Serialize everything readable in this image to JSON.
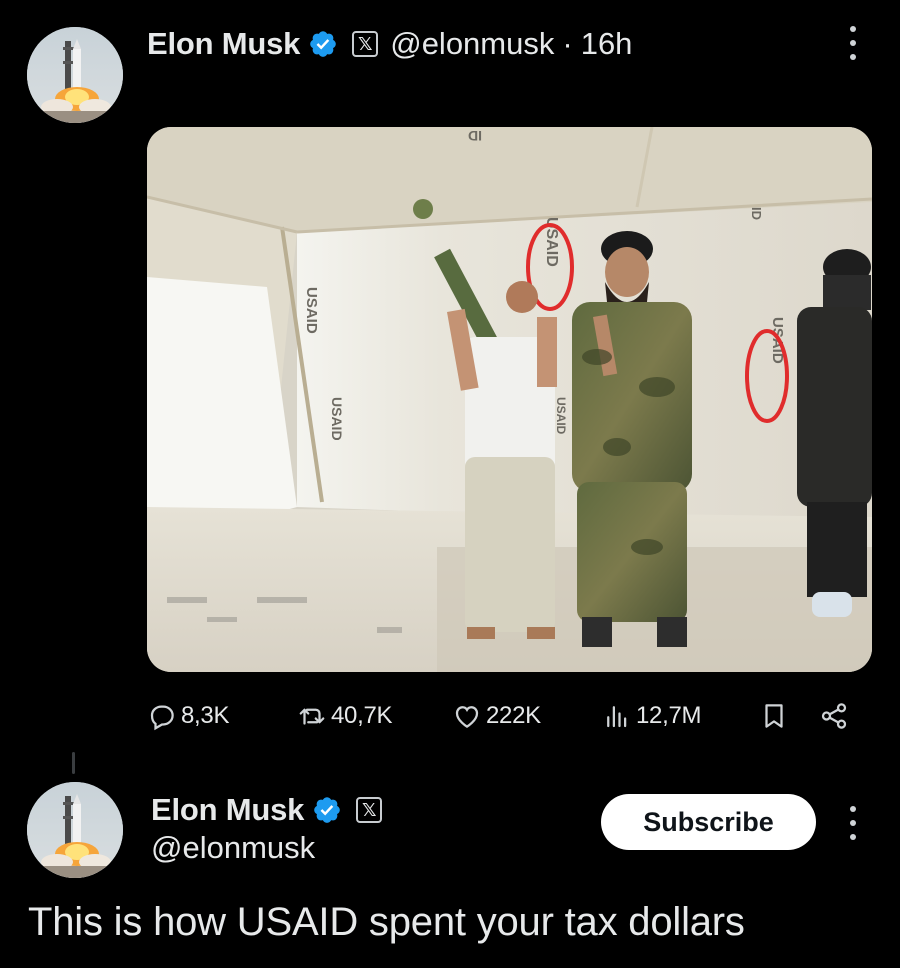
{
  "post": {
    "author_name": "Elon Musk",
    "handle": "@elonmusk",
    "separator": "·",
    "time": "16h",
    "media_texts": [
      "USAID",
      "USAID",
      "USAID",
      "USAID",
      "USAID",
      "ID",
      "ID"
    ],
    "actions": {
      "replies": "8,3K",
      "reposts": "40,7K",
      "likes": "222K",
      "views": "12,7M"
    }
  },
  "reply": {
    "author_name": "Elon Musk",
    "handle": "@elonmusk",
    "subscribe_label": "Subscribe",
    "text": "This is how USAID spent your tax dollars"
  },
  "colors": {
    "background": "#000000",
    "verified_blue": "#1d9bf0",
    "text": "#e7e9ea",
    "icon": "#cfd3d6"
  },
  "icons": {
    "verified": "verified-badge-icon",
    "affiliate": "x-logo-icon",
    "more": "more-options-icon",
    "reply": "reply-icon",
    "repost": "repost-icon",
    "like": "heart-icon",
    "views": "views-bar-chart-icon",
    "bookmark": "bookmark-icon",
    "share": "share-icon"
  }
}
